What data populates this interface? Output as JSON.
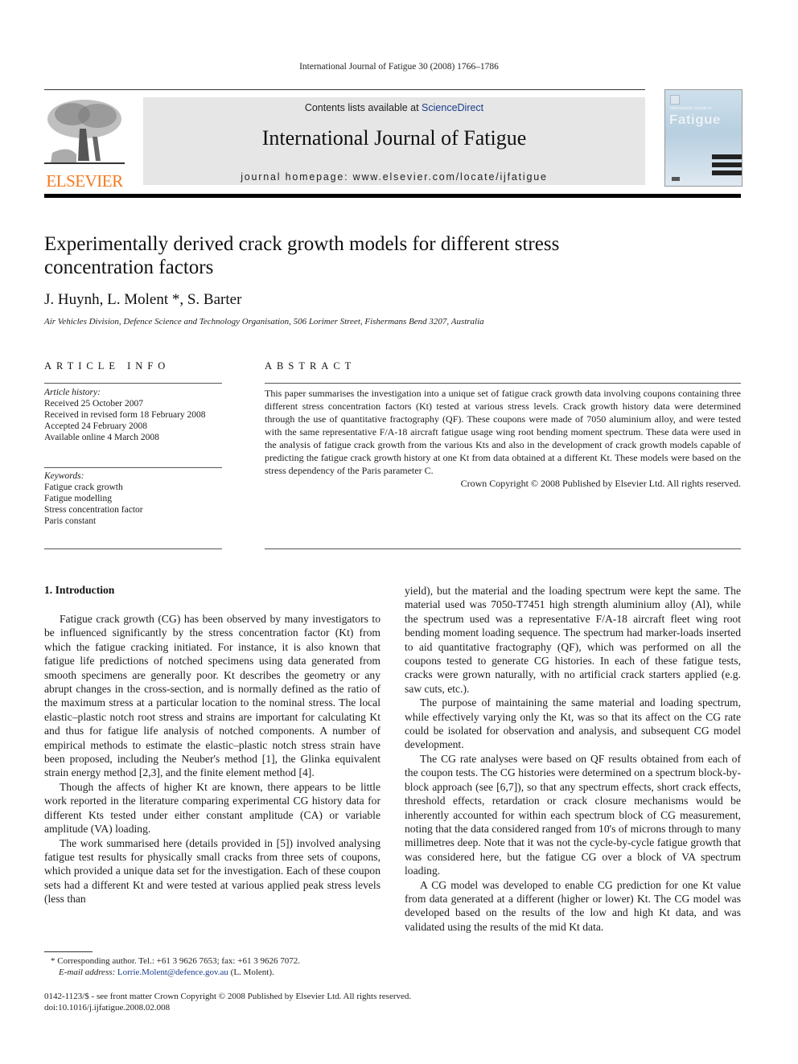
{
  "running_head": "International Journal of Fatigue 30 (2008) 1766–1786",
  "masthead": {
    "publisher_logo_text": "ELSEVIER",
    "contents_prefix": "Contents lists available at ",
    "contents_link": "ScienceDirect",
    "journal_title": "International Journal of Fatigue",
    "homepage": "journal homepage: www.elsevier.com/locate/ijfatigue",
    "cover": {
      "kicker": "International Journal of",
      "title": "Fatigue"
    },
    "colors": {
      "publisher_orange": "#f47920",
      "link_blue": "#1a3c8c",
      "masthead_bg": "#e6e6e6"
    }
  },
  "article": {
    "title": "Experimentally derived crack growth models for different stress concentration factors",
    "authors": "J. Huynh, L. Molent *, S. Barter",
    "affiliation": "Air Vehicles Division, Defence Science and Technology Organisation, 506 Lorimer Street, Fishermans Bend 3207, Australia"
  },
  "article_info": {
    "heading": "ARTICLE INFO",
    "history_label": "Article history:",
    "history": [
      "Received 25 October 2007",
      "Received in revised form 18 February 2008",
      "Accepted 24 February 2008",
      "Available online 4 March 2008"
    ],
    "keywords_label": "Keywords:",
    "keywords": [
      "Fatigue crack growth",
      "Fatigue modelling",
      "Stress concentration factor",
      "Paris constant"
    ]
  },
  "abstract": {
    "heading": "ABSTRACT",
    "text": "This paper summarises the investigation into a unique set of fatigue crack growth data involving coupons containing three different stress concentration factors (Kt) tested at various stress levels. Crack growth history data were determined through the use of quantitative fractography (QF). These coupons were made of 7050 aluminium alloy, and were tested with the same representative F/A-18 aircraft fatigue usage wing root bending moment spectrum. These data were used in the analysis of fatigue crack growth from the various Kts and also in the development of crack growth models capable of predicting the fatigue crack growth history at one Kt from data obtained at a different Kt. These models were based on the stress dependency of the Paris parameter C.",
    "copyright": "Crown Copyright © 2008 Published by Elsevier Ltd. All rights reserved."
  },
  "body": {
    "section_heading": "1.  Introduction",
    "left_paragraphs": [
      "Fatigue crack growth (CG) has been observed by many investigators to be influenced significantly by the stress concentration factor (Kt) from which the fatigue cracking initiated. For instance, it is also known that fatigue life predictions of notched specimens using data generated from smooth specimens are generally poor. Kt describes the geometry or any abrupt changes in the cross-section, and is normally defined as the ratio of the maximum stress at a particular location to the nominal stress. The local elastic–plastic notch root stress and strains are important for calculating Kt and thus for fatigue life analysis of notched components. A number of empirical methods to estimate the elastic–plastic notch stress strain have been proposed, including the Neuber's method [1], the Glinka equivalent strain energy method [2,3], and the finite element method [4].",
      "Though the affects of higher Kt are known, there appears to be little work reported in the literature comparing experimental CG history data for different Kts tested under either constant amplitude (CA) or variable amplitude (VA) loading.",
      "The work summarised here (details provided in [5]) involved analysing fatigue test results for physically small cracks from three sets of coupons, which provided a unique data set for the investigation. Each of these coupon sets had a different Kt and were tested at various applied peak stress levels (less than"
    ],
    "right_paragraphs": [
      "yield), but the material and the loading spectrum were kept the same. The material used was 7050-T7451 high strength aluminium alloy (Al), while the spectrum used was a representative F/A-18 aircraft fleet wing root bending moment loading sequence. The spectrum had marker-loads inserted to aid quantitative fractography (QF), which was performed on all the coupons tested to generate CG histories. In each of these fatigue tests, cracks were grown naturally, with no artificial crack starters applied (e.g. saw cuts, etc.).",
      "The purpose of maintaining the same material and loading spectrum, while effectively varying only the Kt, was so that its affect on the CG rate could be isolated for observation and analysis, and subsequent CG model development.",
      "The CG rate analyses were based on QF results obtained from each of the coupon tests. The CG histories were determined on a spectrum block-by-block approach (see [6,7]), so that any spectrum effects, short crack effects, threshold effects, retardation or crack closure mechanisms would be inherently accounted for within each spectrum block of CG measurement, noting that the data considered ranged from 10's of microns through to many millimetres deep. Note that it was not the cycle-by-cycle fatigue growth that was considered here, but the fatigue CG over a block of VA spectrum loading.",
      "A CG model was developed to enable CG prediction for one Kt value from data generated at a different (higher or lower) Kt. The CG model was developed based on the results of the low and high Kt data, and was validated using the results of the mid Kt data."
    ]
  },
  "footnote": {
    "corresponding": "* Corresponding author. Tel.: +61 3 9626 7653; fax: +61 3 9626 7072.",
    "email_label": "E-mail address: ",
    "email": "Lorrie.Molent@defence.gov.au",
    "email_suffix": " (L. Molent)."
  },
  "bottom_meta": {
    "issn_line": "0142-1123/$ - see front matter Crown Copyright © 2008 Published by Elsevier Ltd. All rights reserved.",
    "doi": "doi:10.1016/j.ijfatigue.2008.02.008"
  }
}
